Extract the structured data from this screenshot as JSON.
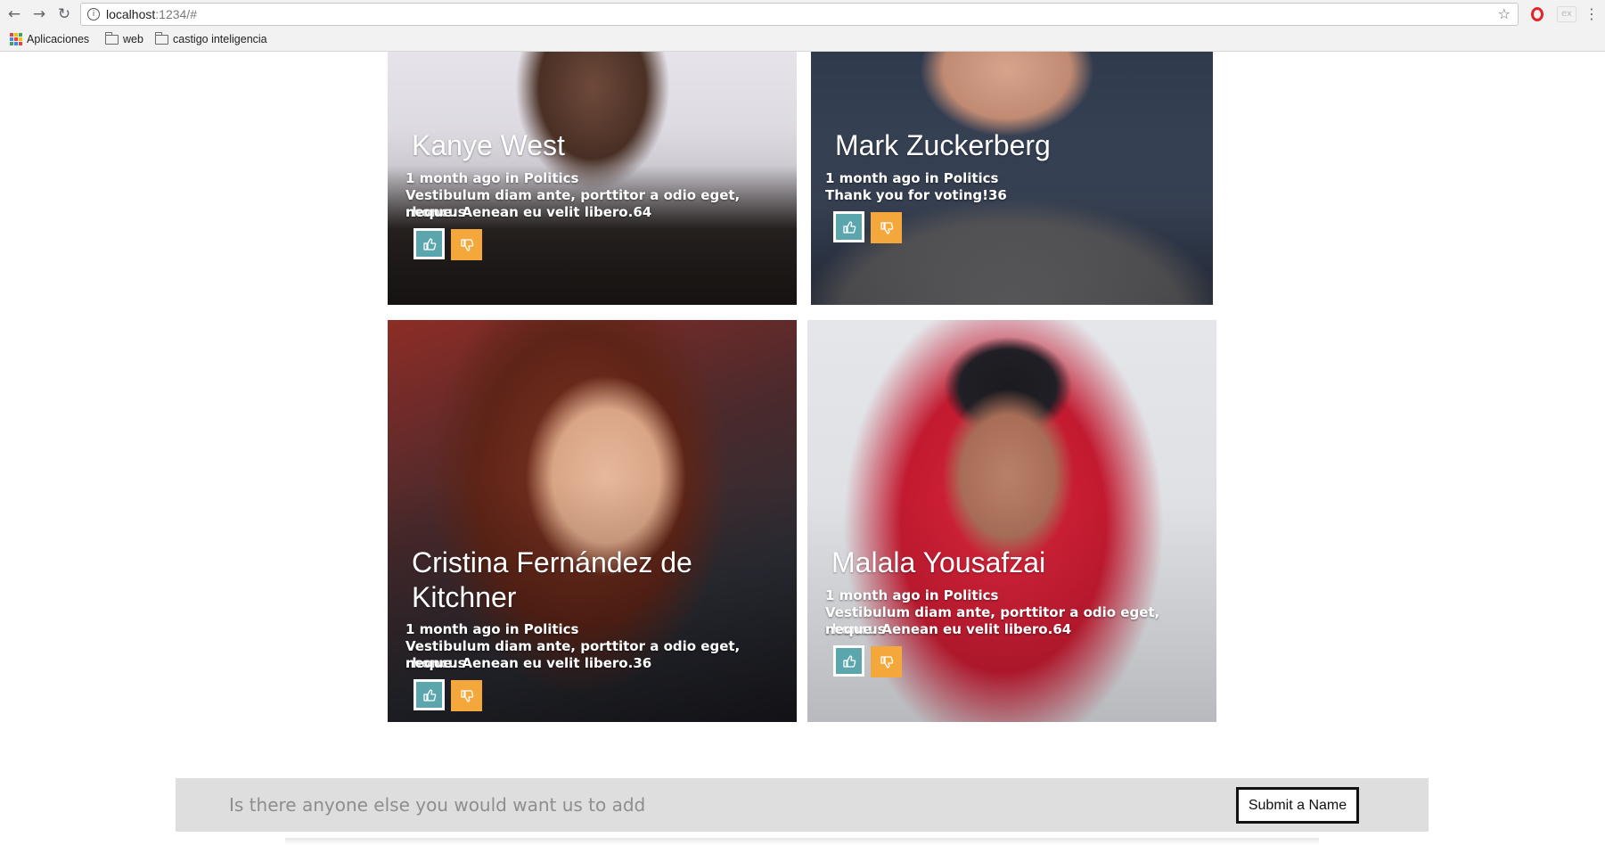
{
  "browser": {
    "url_host": "localhost",
    "url_rest": ":1234/#",
    "bookmarks": [
      {
        "label": "Aplicaciones",
        "icon": "apps-icon"
      },
      {
        "label": "web",
        "icon": "folder-icon"
      },
      {
        "label": "castigo inteligencia",
        "icon": "folder-icon"
      }
    ]
  },
  "cards": [
    {
      "name": "Kanye West",
      "meta": "1 month ago in Politics",
      "body_line1": "Vestibulum diam ante, porttitor a odio eget, rhoncus",
      "body_line2": "neque. Aenean eu velit libero.64"
    },
    {
      "name": "Mark Zuckerberg",
      "meta": "1 month ago in Politics",
      "body_line1": "Thank you for voting!36",
      "body_line2": ""
    },
    {
      "name_line1": "Cristina Fernández de",
      "name_line2": "Kitchner",
      "meta": "1 month ago in Politics",
      "body_line1": "Vestibulum diam ante, porttitor a odio eget, rhoncus",
      "body_line2": "neque. Aenean eu velit libero.36"
    },
    {
      "name": "Malala Yousafzai",
      "meta": "1 month ago in Politics",
      "body_line1": "Vestibulum diam ante, porttitor a odio eget, rhoncus",
      "body_line2": "neque. Aenean eu velit libero.64"
    }
  ],
  "colors": {
    "vote_up": "#5aa6ac",
    "vote_down": "#f4a83c",
    "suggest_bar": "#dedede"
  },
  "icons": {
    "vote_up": "thumbs-up-icon",
    "vote_down": "thumbs-down-icon"
  },
  "suggest": {
    "placeholder": "Is there anyone else you would want us to add",
    "submit_label": "Submit a Name"
  }
}
